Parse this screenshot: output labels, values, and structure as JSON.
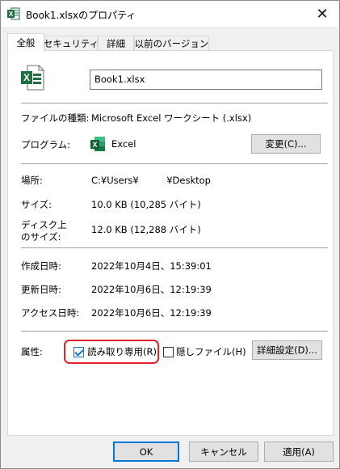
{
  "window": {
    "title": "Book1.xlsxのプロパティ",
    "close_symbol": "✕"
  },
  "tabs": [
    {
      "label": "全般",
      "active": true
    },
    {
      "label": "セキュリティ",
      "active": false
    },
    {
      "label": "詳細",
      "active": false
    },
    {
      "label": "以前のバージョン",
      "active": false
    }
  ],
  "general": {
    "file_icon": "excel-file-icon",
    "filename": "Book1.xlsx",
    "file_type_label": "ファイルの種類:",
    "file_type_value": "Microsoft Excel ワークシート (.xlsx)",
    "program_label": "プログラム:",
    "program_icon": "excel-app-icon",
    "program_value": "Excel",
    "change_button": "変更(C)...",
    "location_label": "場所:",
    "location_value": "C:¥Users¥　　　¥Desktop",
    "size_label": "サイズ:",
    "size_value": "10.0 KB (10,285 バイト)",
    "disk_size_label_1": "ディスク上",
    "disk_size_label_2": "のサイズ:",
    "disk_size_value": "12.0 KB (12,288 バイト)",
    "created_label": "作成日時:",
    "created_value": "2022年10月4日、15:39:01",
    "modified_label": "更新日時:",
    "modified_value": "2022年10月6日、12:19:39",
    "accessed_label": "アクセス日時:",
    "accessed_value": "2022年10月6日、12:19:39",
    "attributes_label": "属性:",
    "readonly_label": "読み取り専用(R)",
    "readonly_checked": true,
    "hidden_label": "隠しファイル(H)",
    "hidden_checked": false,
    "advanced_button": "詳細設定(D)..."
  },
  "footer": {
    "ok": "OK",
    "cancel": "キャンセル",
    "apply": "適用(A)"
  },
  "colors": {
    "excel_green": "#1d6f42",
    "accent": "#0078d7",
    "highlight": "#e3222b"
  }
}
